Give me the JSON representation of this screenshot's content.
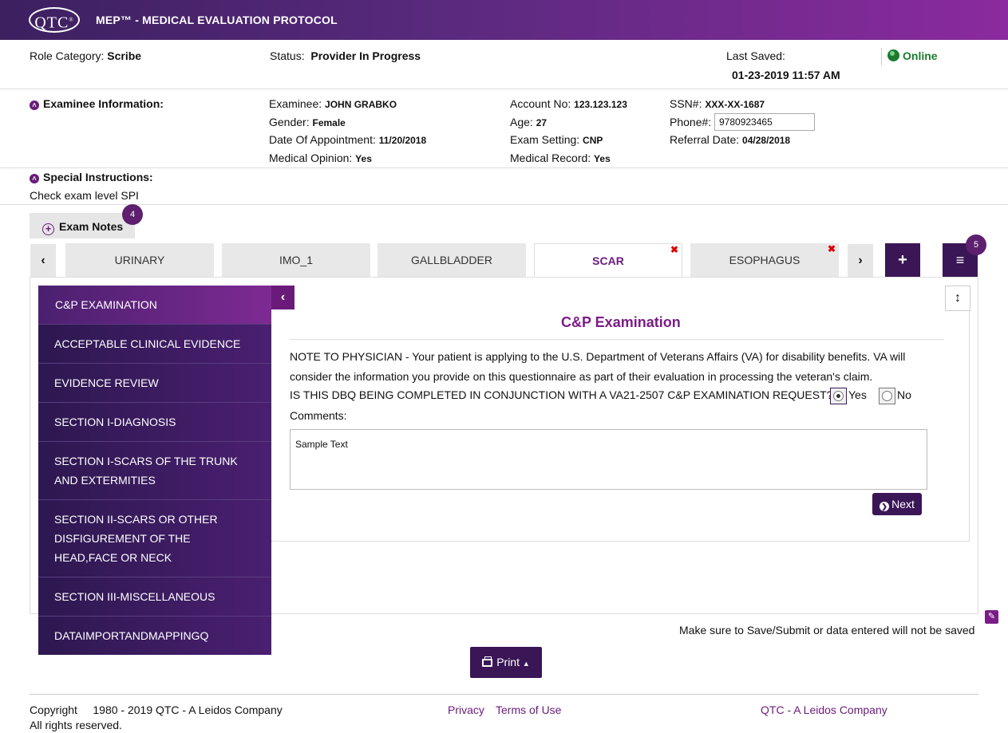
{
  "header": {
    "logo_text": "QTC",
    "app_title": "MEP™ - MEDICAL EVALUATION PROTOCOL"
  },
  "status_bar": {
    "role_label": "Role Category:",
    "role_value": "Scribe",
    "status_label": "Status:",
    "status_value": "Provider In Progress",
    "last_saved_label": "Last Saved:",
    "last_saved_value": "01-23-2019 11:57 AM",
    "connection": "Online"
  },
  "examinee": {
    "section_label": "Examinee Information:",
    "fields": {
      "examinee_label": "Examinee:",
      "examinee_value": "JOHN GRABKO",
      "gender_label": "Gender:",
      "gender_value": "Female",
      "doa_label": "Date Of Appointment:",
      "doa_value": "11/20/2018",
      "medop_label": "Medical Opinion:",
      "medop_value": "Yes",
      "account_label": "Account No:",
      "account_value": "123.123.123",
      "age_label": "Age:",
      "age_value": "27",
      "setting_label": "Exam Setting:",
      "setting_value": "CNP",
      "medrec_label": "Medical Record:",
      "medrec_value": "Yes",
      "ssn_label": "SSN#:",
      "ssn_value": "XXX-XX-1687",
      "phone_label": "Phone#:",
      "phone_value": "9780923465",
      "referral_label": "Referral Date:",
      "referral_value": "04/28/2018"
    }
  },
  "special_instructions": {
    "label": "Special Instructions:",
    "text": "Check exam level SPI"
  },
  "exam_notes": {
    "label": "Exam Notes",
    "count": "4"
  },
  "tabs": [
    {
      "label": "URINARY",
      "active": false,
      "closable": false
    },
    {
      "label": "IMO_1",
      "active": false,
      "closable": false
    },
    {
      "label": "GALLBLADDER",
      "active": false,
      "closable": false
    },
    {
      "label": "SCAR",
      "active": true,
      "closable": true
    },
    {
      "label": "ESOPHAGUS",
      "active": false,
      "closable": true
    }
  ],
  "menu_badge": "5",
  "sidenav": [
    "C&P EXAMINATION",
    "ACCEPTABLE CLINICAL EVIDENCE",
    "EVIDENCE REVIEW",
    "SECTION I-DIAGNOSIS",
    "SECTION I-SCARS OF THE TRUNK AND EXTERMITIES",
    "SECTION II-SCARS OR OTHER DISFIGUREMENT OF THE HEAD,FACE OR NECK",
    "SECTION III-MISCELLANEOUS",
    "DATAIMPORTANDMAPPINGQ"
  ],
  "form": {
    "title": "C&P Examination",
    "note": "NOTE TO PHYSICIAN - Your patient is applying to the U.S. Department of Veterans Affairs (VA) for disability benefits. VA will consider the information you provide on this questionnaire as part of their evaluation in processing the veteran's claim.",
    "question": "IS THIS DBQ BEING COMPLETED IN CONJUNCTION WITH A VA21-2507 C&P EXAMINATION REQUEST?",
    "yes_label": "Yes",
    "no_label": "No",
    "selected": "Yes",
    "comments_label": "Comments:",
    "comments_value": "Sample Text",
    "next_label": "Next"
  },
  "warning": "Make sure to Save/Submit or data entered will not be saved",
  "print_label": "Print",
  "footer": {
    "copyright_label": "Copyright",
    "copyright_years": "1980 - 2019  QTC - A Leidos Company",
    "rights": "All rights reserved.",
    "privacy": "Privacy",
    "terms": "Terms of Use",
    "company_link": "QTC - A Leidos Company"
  },
  "colors": {
    "brand_dark": "#3a1656",
    "brand_purple": "#7a1d86",
    "online_green": "#1a7a2e"
  },
  "icons": [
    "globe-icon",
    "chevron-up-icon",
    "plus-circle-icon",
    "chevron-left-icon",
    "chevron-right-icon",
    "plus-icon",
    "hamburger-icon",
    "close-icon",
    "resize-vertical-icon",
    "arrow-circle-right-icon",
    "edit-icon",
    "printer-icon",
    "caret-up-icon"
  ]
}
